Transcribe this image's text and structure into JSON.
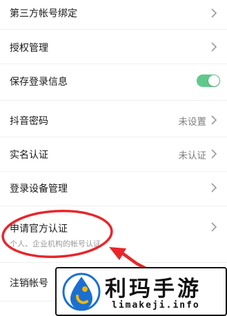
{
  "settings": {
    "items": [
      {
        "label": "第三方帐号绑定"
      },
      {
        "label": "授权管理"
      },
      {
        "label": "保存登录信息",
        "toggle_on": true
      },
      {
        "label": "抖音密码",
        "value": "未设置"
      },
      {
        "label": "实名认证",
        "value": "未认证"
      },
      {
        "label": "登录设备管理"
      },
      {
        "label": "申请官方认证",
        "sub": "个人、企业机构的帐号认证"
      },
      {
        "label": "注销帐号"
      }
    ]
  },
  "annotation": {
    "color": "#e8262a"
  },
  "watermark": {
    "title": "利玛手游",
    "url": "limakeji.info",
    "logo": "droplet-logo-icon"
  },
  "colors": {
    "toggle_on": "#5ec98a",
    "annotation": "#e8262a"
  }
}
